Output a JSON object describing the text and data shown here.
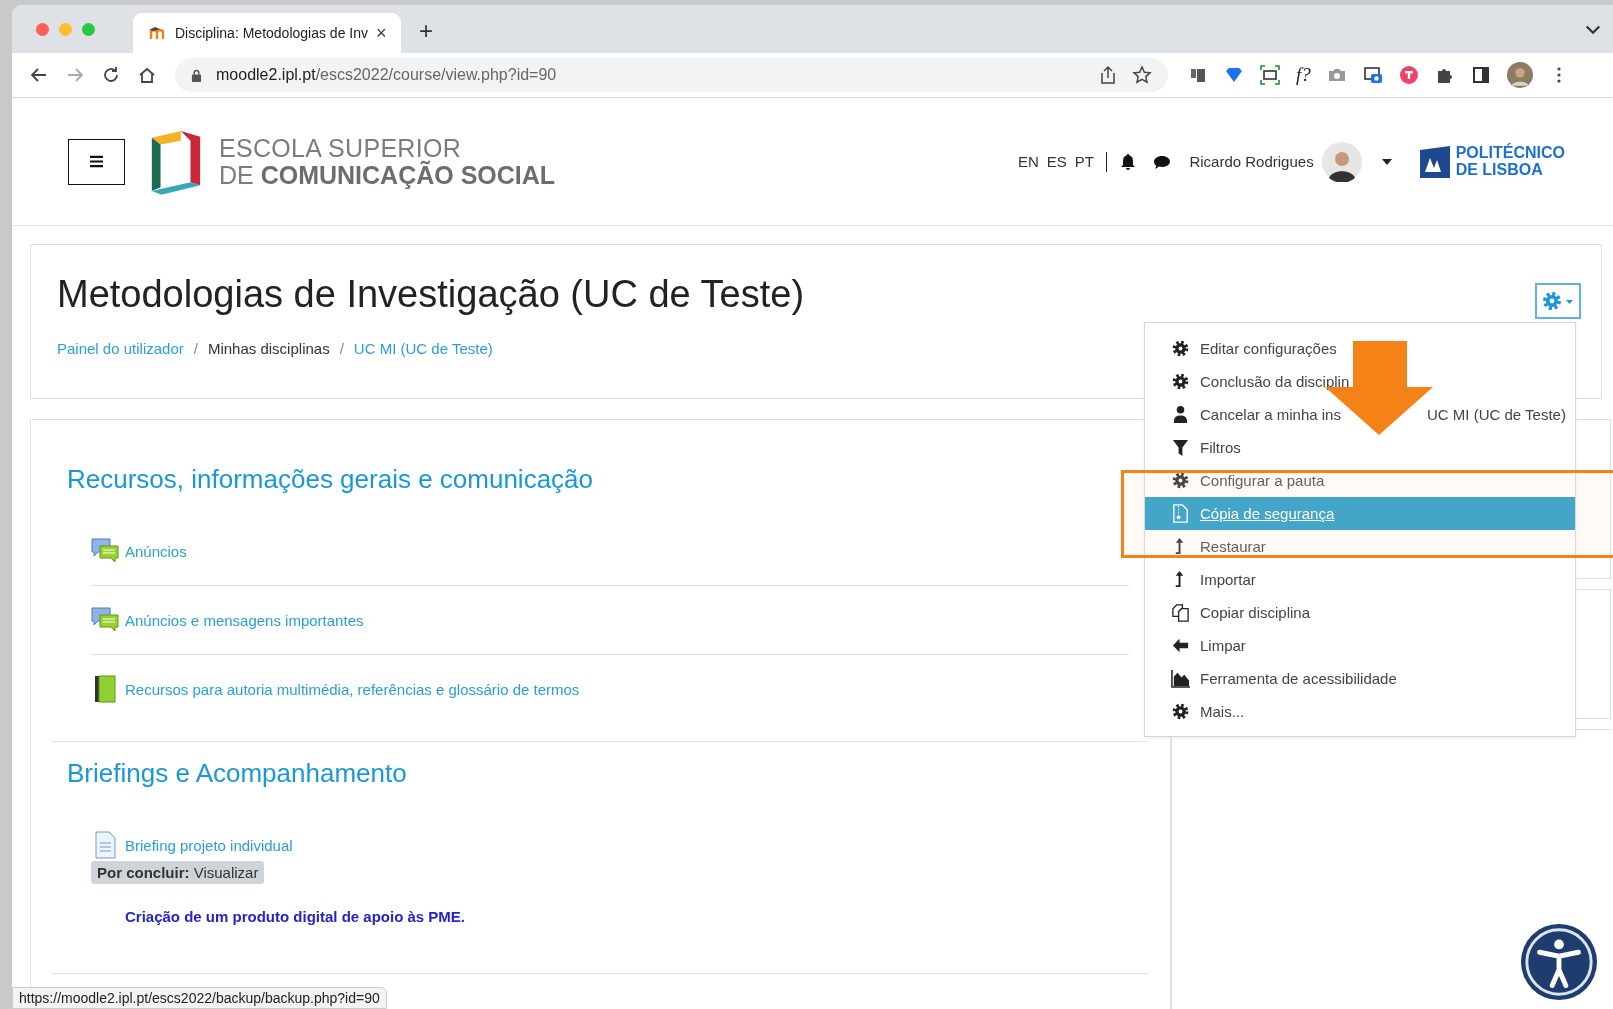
{
  "browser": {
    "tab": {
      "title": "Disciplina: Metodologias de Inv",
      "close": "×"
    },
    "new_tab": "+",
    "url": {
      "host": "moodle2.ipl.pt",
      "path": "/escs2022/course/view.php?id=90"
    },
    "extension_label": "f?"
  },
  "logo": {
    "line1": "ESCOLA SUPERIOR",
    "line2_light": "DE",
    "line2_bold": "COMUNICAÇÃO SOCIAL"
  },
  "header": {
    "languages": [
      "EN",
      "ES",
      "PT"
    ],
    "user_name": "Ricardo Rodrigues"
  },
  "partner_logo": {
    "line1": "POLITÉCNICO",
    "line2": "DE LISBOA"
  },
  "course": {
    "title": "Metodologias de Investigação (UC de Teste)",
    "breadcrumb": [
      {
        "label": "Painel do utilizador",
        "link": true
      },
      {
        "separator": "/",
        "label": "Minhas disciplinas",
        "link": false
      },
      {
        "separator": "/",
        "label": "UC MI (UC de Teste)",
        "link": true
      }
    ]
  },
  "sections": [
    {
      "title": "Recursos, informações gerais e comunicação",
      "activities": [
        {
          "kind": "forum",
          "label": "Anúncios"
        },
        {
          "kind": "forum",
          "label": "Anúncios e mensagens importantes"
        },
        {
          "kind": "book",
          "label": "Recursos para autoria multimédia, referências e glossário de termos"
        }
      ]
    },
    {
      "title": "Briefings e Acompanhamento",
      "activities": [
        {
          "kind": "file",
          "label": "Briefing projeto individual",
          "completion": "**Por concluir:** Visualizar",
          "description": "Criação de um produto digital de apoio às PME."
        }
      ]
    }
  ],
  "settings_menu": {
    "open": true,
    "items": [
      {
        "kind": "gear",
        "label_parts": [
          "Editar configurações"
        ],
        "selected": false
      },
      {
        "kind": "gear",
        "label_parts": [
          "Conclusão da disciplin"
        ],
        "selected": false
      },
      {
        "kind": "user",
        "label_parts": [
          "Cancelar a minha ins",
          "UC MI (UC de Teste)"
        ],
        "selected": false
      },
      {
        "kind": "filter",
        "label_parts": [
          "Filtros"
        ],
        "selected": false
      },
      {
        "kind": "gear",
        "label_parts": [
          "Configurar a pauta"
        ],
        "selected": false
      },
      {
        "kind": "backup",
        "label_parts": [
          "Cópia de segurança"
        ],
        "selected": true
      },
      {
        "kind": "upload",
        "label_parts": [
          "Restaurar"
        ],
        "selected": false
      },
      {
        "kind": "upload",
        "label_parts": [
          "Importar"
        ],
        "selected": false
      },
      {
        "kind": "copy",
        "label_parts": [
          "Copiar disciplina"
        ],
        "selected": false
      },
      {
        "kind": "back",
        "label_parts": [
          "Limpar"
        ],
        "selected": false
      },
      {
        "kind": "chart",
        "label_parts": [
          "Ferramenta de acessibilidade"
        ],
        "selected": false
      },
      {
        "kind": "gear",
        "label_parts": [
          "Mais..."
        ],
        "selected": false
      }
    ]
  },
  "status_bar": {
    "url": "https://moodle2.ipl.pt/escs2022/backup/backup.php?id=90"
  }
}
